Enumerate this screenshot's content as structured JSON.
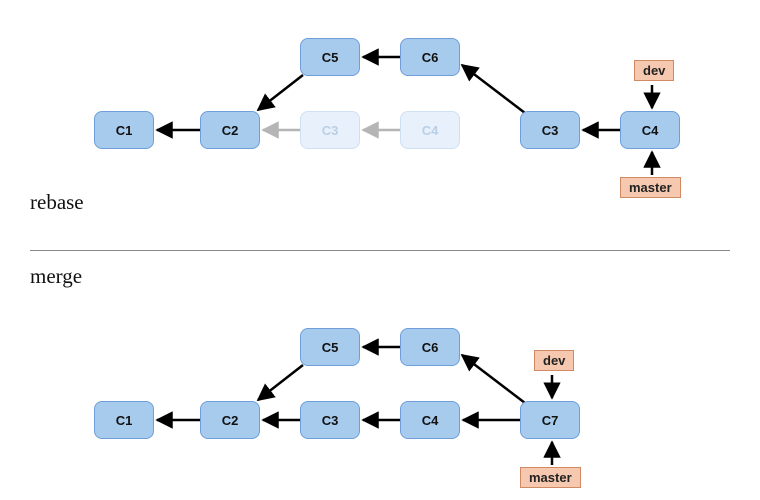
{
  "diagram": {
    "rebase": {
      "caption": "rebase",
      "commits": {
        "c1": {
          "label": "C1",
          "ghost": false
        },
        "c2": {
          "label": "C2",
          "ghost": false
        },
        "c3g": {
          "label": "C3",
          "ghost": true
        },
        "c4g": {
          "label": "C4",
          "ghost": true
        },
        "c3": {
          "label": "C3",
          "ghost": false
        },
        "c4": {
          "label": "C4",
          "ghost": false
        },
        "c5": {
          "label": "C5",
          "ghost": false
        },
        "c6": {
          "label": "C6",
          "ghost": false
        }
      },
      "branches": {
        "dev": "dev",
        "master": "master"
      }
    },
    "merge": {
      "caption": "merge",
      "commits": {
        "c1": {
          "label": "C1",
          "ghost": false
        },
        "c2": {
          "label": "C2",
          "ghost": false
        },
        "c3": {
          "label": "C3",
          "ghost": false
        },
        "c4": {
          "label": "C4",
          "ghost": false
        },
        "c5": {
          "label": "C5",
          "ghost": false
        },
        "c6": {
          "label": "C6",
          "ghost": false
        },
        "c7": {
          "label": "C7",
          "ghost": false
        }
      },
      "branches": {
        "dev": "dev",
        "master": "master"
      }
    }
  },
  "chart_data": [
    {
      "name": "rebase",
      "type": "diagram",
      "title": "rebase",
      "nodes": [
        {
          "id": "C1",
          "kind": "commit",
          "state": "normal"
        },
        {
          "id": "C2",
          "kind": "commit",
          "state": "normal"
        },
        {
          "id": "C3_ghost",
          "label": "C3",
          "kind": "commit",
          "state": "ghost"
        },
        {
          "id": "C4_ghost",
          "label": "C4",
          "kind": "commit",
          "state": "ghost"
        },
        {
          "id": "C3",
          "kind": "commit",
          "state": "normal"
        },
        {
          "id": "C4",
          "kind": "commit",
          "state": "normal"
        },
        {
          "id": "C5",
          "kind": "commit",
          "state": "normal"
        },
        {
          "id": "C6",
          "kind": "commit",
          "state": "normal"
        },
        {
          "id": "dev",
          "kind": "branch"
        },
        {
          "id": "master",
          "kind": "branch"
        }
      ],
      "edges": [
        {
          "from": "C2",
          "to": "C1",
          "style": "solid"
        },
        {
          "from": "C3_ghost",
          "to": "C2",
          "style": "ghost"
        },
        {
          "from": "C4_ghost",
          "to": "C3_ghost",
          "style": "ghost"
        },
        {
          "from": "C3",
          "to": "C6",
          "style": "solid"
        },
        {
          "from": "C4",
          "to": "C3",
          "style": "solid"
        },
        {
          "from": "C6",
          "to": "C5",
          "style": "solid"
        },
        {
          "from": "C5",
          "to": "C2",
          "style": "solid"
        },
        {
          "from": "dev",
          "to": "C4",
          "style": "solid"
        },
        {
          "from": "master",
          "to": "C4",
          "style": "solid"
        }
      ]
    },
    {
      "name": "merge",
      "type": "diagram",
      "title": "merge",
      "nodes": [
        {
          "id": "C1",
          "kind": "commit",
          "state": "normal"
        },
        {
          "id": "C2",
          "kind": "commit",
          "state": "normal"
        },
        {
          "id": "C3",
          "kind": "commit",
          "state": "normal"
        },
        {
          "id": "C4",
          "kind": "commit",
          "state": "normal"
        },
        {
          "id": "C5",
          "kind": "commit",
          "state": "normal"
        },
        {
          "id": "C6",
          "kind": "commit",
          "state": "normal"
        },
        {
          "id": "C7",
          "kind": "commit",
          "state": "normal"
        },
        {
          "id": "dev",
          "kind": "branch"
        },
        {
          "id": "master",
          "kind": "branch"
        }
      ],
      "edges": [
        {
          "from": "C2",
          "to": "C1",
          "style": "solid"
        },
        {
          "from": "C3",
          "to": "C2",
          "style": "solid"
        },
        {
          "from": "C4",
          "to": "C3",
          "style": "solid"
        },
        {
          "from": "C7",
          "to": "C4",
          "style": "solid"
        },
        {
          "from": "C5",
          "to": "C2",
          "style": "solid"
        },
        {
          "from": "C6",
          "to": "C5",
          "style": "solid"
        },
        {
          "from": "C7",
          "to": "C6",
          "style": "solid"
        },
        {
          "from": "dev",
          "to": "C7",
          "style": "solid"
        },
        {
          "from": "master",
          "to": "C7",
          "style": "solid"
        }
      ]
    }
  ]
}
